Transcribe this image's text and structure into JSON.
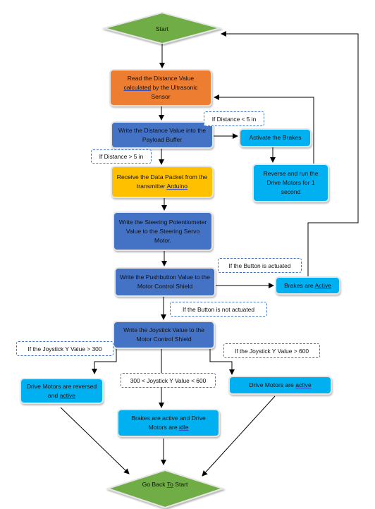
{
  "start": {
    "label": "Start",
    "color": "#70AD47"
  },
  "steps": {
    "read_distance": {
      "pre": "Read the Distance Value ",
      "underlined": "calculated",
      "post": " by the Ultrasonic Sensor",
      "color": "#ED7D31"
    },
    "write_distance": {
      "label": "Write the Distance Value into the Payload Buffer",
      "color": "#4472C4"
    },
    "activate_brakes": {
      "label": "Activate the Brakes",
      "color": "#00B0F0"
    },
    "reverse_motors": {
      "label": "Reverse and run the Drive Motors for 1 second"
    },
    "receive_packet": {
      "pre": "Receive the Data Packet from the transmitter ",
      "underlined": "Arduino",
      "color": "#FFC000"
    },
    "write_steering": {
      "label": "Write the Steering Potentiometer Value to the Steering Servo Motor."
    },
    "write_pushbutton": {
      "label": "Write the Pushbutton Value to the Motor Control Shield"
    },
    "brakes_active": {
      "pre": "Brakes are ",
      "underlined": "Active"
    },
    "write_joystick": {
      "label": "Write the Joystick Value to the Motor Control Shield"
    },
    "motors_reversed": {
      "pre": "Drive Motors are reversed and ",
      "underlined": "active"
    },
    "brakes_idle": {
      "pre": "Brakes are active and Drive Motors are ",
      "underlined": "idle"
    },
    "motors_active": {
      "pre": "Drive Motors are ",
      "underlined": "active"
    }
  },
  "conditions": {
    "distance_lt_5": "If Distance < 5 in",
    "distance_gt_5": "If Distance > 5 in",
    "button_actuated": "If the Button is actuated",
    "button_not_actuated": "If the Button is not actuated",
    "joystick_gt_300": "If the Joystick Y Value > 300",
    "joystick_between": "300 < Joystick Y Value < 600",
    "joystick_gt_600": "If the Joystick Y Value > 600"
  },
  "end": {
    "pre": "Go Back ",
    "underlined": "To",
    "post": " Start"
  }
}
